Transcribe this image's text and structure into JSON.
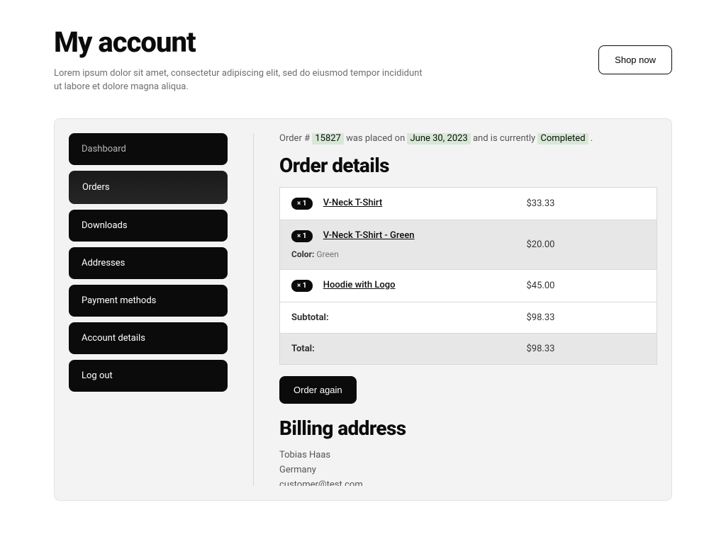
{
  "header": {
    "title": "My account",
    "description": "Lorem ipsum dolor sit amet, consectetur adipiscing elit, sed do eiusmod tempor incididunt ut labore et dolore magna aliqua.",
    "shop_button": "Shop now"
  },
  "sidebar": {
    "items": [
      {
        "label": "Dashboard",
        "active": false
      },
      {
        "label": "Orders",
        "active": true
      },
      {
        "label": "Downloads",
        "active": false
      },
      {
        "label": "Addresses",
        "active": false
      },
      {
        "label": "Payment methods",
        "active": false
      },
      {
        "label": "Account details",
        "active": false
      },
      {
        "label": "Log out",
        "active": false
      }
    ]
  },
  "order": {
    "summary_prefix": "Order #",
    "number": "15827",
    "summary_mid1": " was placed on ",
    "date": "June 30, 2023",
    "summary_mid2": " and is currently ",
    "status": "Completed",
    "summary_suffix": "."
  },
  "order_details": {
    "heading": "Order details",
    "items": [
      {
        "qty": "× 1",
        "name": "V-Neck T-Shirt",
        "total": "$33.33",
        "variation_label": "",
        "variation_value": ""
      },
      {
        "qty": "× 1",
        "name": "V-Neck T-Shirt - Green",
        "total": "$20.00",
        "variation_label": "Color:",
        "variation_value": "Green"
      },
      {
        "qty": "× 1",
        "name": "Hoodie with Logo",
        "total": "$45.00",
        "variation_label": "",
        "variation_value": ""
      }
    ],
    "subtotal_label": "Subtotal:",
    "subtotal_value": "$98.33",
    "total_label": "Total:",
    "total_value": "$98.33",
    "order_again": "Order again"
  },
  "billing": {
    "heading": "Billing address",
    "name": "Tobias Haas",
    "country": "Germany",
    "email": "customer@test.com"
  }
}
